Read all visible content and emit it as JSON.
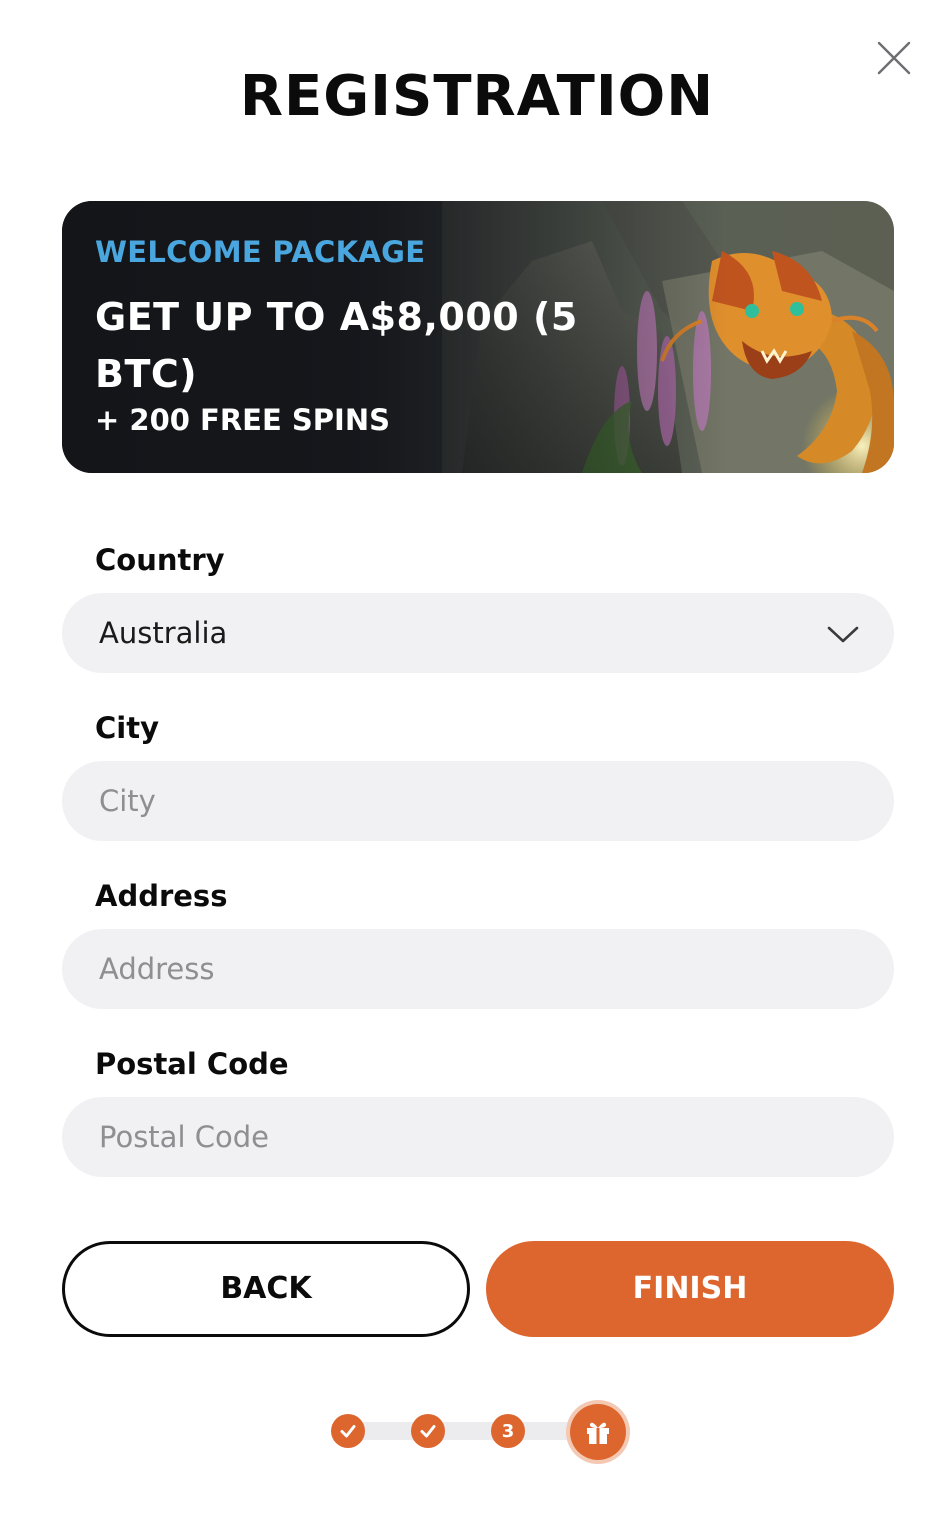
{
  "modal": {
    "title": "REGISTRATION"
  },
  "banner": {
    "eyebrow": "WELCOME PACKAGE",
    "headline": "GET UP TO A$8,000 (5 BTC)",
    "subline": "+ 200 FREE SPINS"
  },
  "form": {
    "country": {
      "label": "Country",
      "value": "Australia"
    },
    "city": {
      "label": "City",
      "placeholder": "City",
      "value": ""
    },
    "address": {
      "label": "Address",
      "placeholder": "Address",
      "value": ""
    },
    "postal_code": {
      "label": "Postal Code",
      "placeholder": "Postal Code",
      "value": ""
    }
  },
  "actions": {
    "back_label": "BACK",
    "finish_label": "FINISH"
  },
  "progress": {
    "steps": [
      {
        "state": "complete",
        "icon": "check-icon"
      },
      {
        "state": "complete",
        "icon": "check-icon"
      },
      {
        "state": "current",
        "label": "3"
      },
      {
        "state": "reward",
        "icon": "gift-icon"
      }
    ]
  },
  "colors": {
    "accent": "#dd662f",
    "eyebrow": "#4aa6de",
    "input_bg": "#f1f1f3",
    "text": "#0b0b0b"
  }
}
